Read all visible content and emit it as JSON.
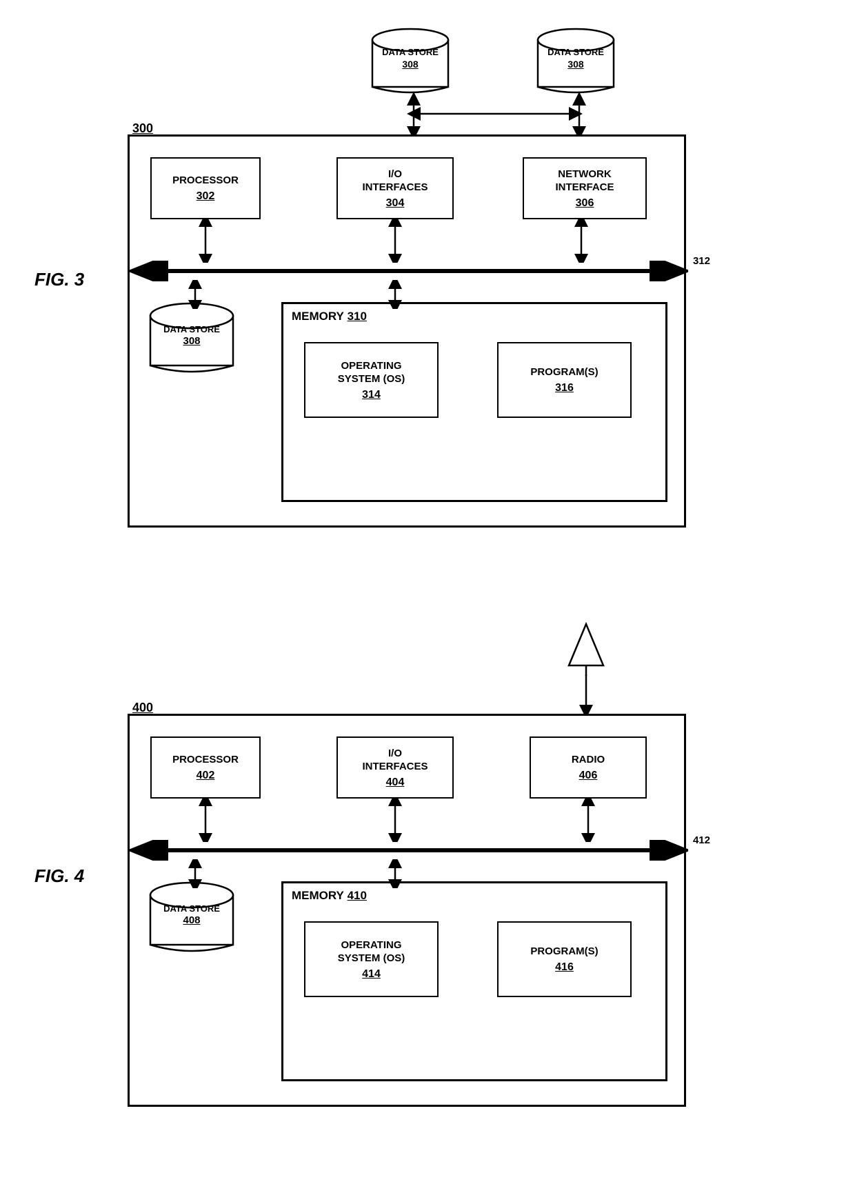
{
  "fig3": {
    "label": "FIG. 3",
    "diagram_ref": "300",
    "bus_ref": "312",
    "components": {
      "processor": {
        "label": "PROCESSOR",
        "num": "302"
      },
      "io": {
        "label": "I/O\nINTERFACES",
        "num": "304"
      },
      "network": {
        "label": "NETWORK\nINTERFACE",
        "num": "306"
      },
      "datastore_top1": {
        "label": "DATA STORE",
        "num": "308"
      },
      "datastore_top2": {
        "label": "DATA STORE",
        "num": "308"
      },
      "datastore_left": {
        "label": "DATA STORE",
        "num": "308"
      },
      "memory": {
        "label": "MEMORY",
        "num": "310"
      },
      "os": {
        "label": "OPERATING\nSYSTEM (OS)",
        "num": "314"
      },
      "programs": {
        "label": "PROGRAM(S)",
        "num": "316"
      }
    }
  },
  "fig4": {
    "label": "FIG. 4",
    "diagram_ref": "400",
    "bus_ref": "412",
    "components": {
      "processor": {
        "label": "PROCESSOR",
        "num": "402"
      },
      "io": {
        "label": "I/O\nINTERFACES",
        "num": "404"
      },
      "radio": {
        "label": "RADIO",
        "num": "406"
      },
      "datastore_left": {
        "label": "DATA STORE",
        "num": "408"
      },
      "memory": {
        "label": "MEMORY",
        "num": "410"
      },
      "os": {
        "label": "OPERATING\nSYSTEM (OS)",
        "num": "414"
      },
      "programs": {
        "label": "PROGRAM(S)",
        "num": "416"
      }
    }
  }
}
